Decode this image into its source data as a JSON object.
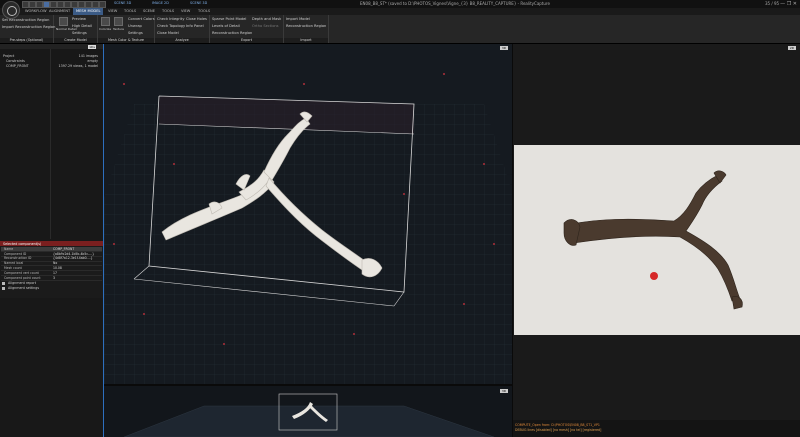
{
  "window": {
    "title": "EN08_B8_ST* (saved to D:\\PHOTOS_Vignes\\Vigne_{3} B8_REALITY_CAPTURE} - RealityCapture",
    "controls": "— ❐ ✕",
    "right_status": "35 / 95"
  },
  "scenes": [
    "SCENE 3D",
    "IMAGE 2D",
    "SCENE 3D"
  ],
  "ribbon_tabs": [
    "WORKFLOW",
    "ALIGNMENT",
    "MESH MODEL",
    "VIEW",
    "TOOLS",
    "SCENE",
    "TOOLS",
    "VIEW",
    "TOOLS"
  ],
  "ribbon_groups": {
    "pre_steps": {
      "label": "Pre-steps (Optional)",
      "items": [
        "Set Reconstruction Region",
        "Import Reconstruction Region"
      ]
    },
    "create_model": {
      "label": "Create Model",
      "big": "Normal Detail",
      "items": [
        "Preview",
        "High Detail",
        "Settings"
      ]
    },
    "mesh_color": {
      "label": "Mesh Color & Texture",
      "big1": "Colorize",
      "big2": "Texture",
      "items": [
        "Convert Colors",
        "Unwrap",
        "Settings"
      ]
    },
    "analyze": {
      "label": "Analyze",
      "items": [
        "Check Integrity",
        "Check Topology",
        "Close Model"
      ],
      "items2": [
        "Close Holes",
        "Info Panel"
      ]
    },
    "export": {
      "label": "Export",
      "items": [
        "Sparse Point Model",
        "Levels of Detail",
        "Reconstruction Region"
      ],
      "items2": [
        "Depth and Mask",
        "Ortho Sections"
      ]
    },
    "import": {
      "label": "Import",
      "items": [
        "Import Model",
        "Reconstruction Region"
      ]
    }
  },
  "left_panel": {
    "button": "1Ds",
    "tree": [
      {
        "label": "Project",
        "value": "141 images"
      },
      {
        "label": "Constraints",
        "value": "empty"
      },
      {
        "label": "COMP_FRONT",
        "value": "1397.29 views, 1 model"
      }
    ]
  },
  "inspector": {
    "title": "Selected component(s)",
    "rows": [
      {
        "key": "Name",
        "value": "COMP_FRONT"
      },
      {
        "key": "Component ID",
        "value": "{a8b9c2d4-1b5b-4b5c-...}"
      },
      {
        "key": "Reconstruction ID",
        "value": "{4d8f7a12-3e1f-4ab0-...}"
      },
      {
        "key": "Named local",
        "value": "No"
      },
      {
        "key": "Mesh count",
        "value": "10.08"
      },
      {
        "key": "Component vert count",
        "value": "17"
      },
      {
        "key": "Component point count",
        "value": "3"
      }
    ],
    "sections": [
      "Alignment report",
      "Alignment settings"
    ]
  },
  "viewport": {
    "badge": "3D",
    "mini_badge": "3D"
  },
  "photo_badge": "2D",
  "console": [
    {
      "text": "COMPUTE_Open from: D:\\PHOTOS\\EN08_B8_ST1_VP1",
      "color": "#e08a3a"
    },
    {
      "text": "DEBUG lines [disabled] [no mesh] [no tel] [registered]",
      "color": "#e0a050"
    }
  ],
  "colors": {
    "accent": "#3b5b86",
    "panel_border": "#2d6fbf",
    "inspector_header": "#7a1f1f"
  }
}
